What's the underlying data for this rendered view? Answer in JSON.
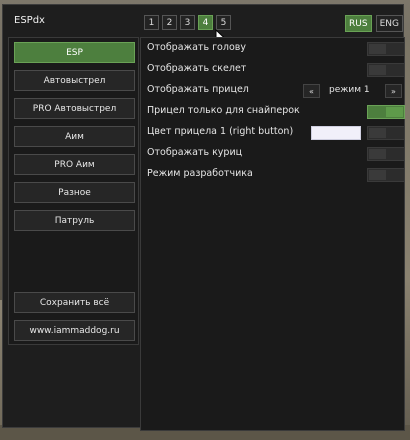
{
  "window": {
    "title": "ESPdx"
  },
  "tabs": [
    {
      "label": "1",
      "active": false
    },
    {
      "label": "2",
      "active": false
    },
    {
      "label": "3",
      "active": false
    },
    {
      "label": "4",
      "active": true
    },
    {
      "label": "5",
      "active": false
    }
  ],
  "lang": {
    "rus": "RUS",
    "eng": "ENG",
    "active": "RUS"
  },
  "sidebar": {
    "items": [
      {
        "label": "ESP",
        "active": true
      },
      {
        "label": "Автовыстрел"
      },
      {
        "label": "PRO Автовыстрел"
      },
      {
        "label": "Аим"
      },
      {
        "label": "PRO Аим"
      },
      {
        "label": "Разное"
      },
      {
        "label": "Патруль"
      }
    ],
    "save_label": "Сохранить всё",
    "site_label": "www.iammaddog.ru"
  },
  "settings": [
    {
      "label": "Отображать голову",
      "on": false
    },
    {
      "label": "Отображать скелет",
      "on": false
    },
    {
      "label": "Отображать прицел",
      "mode": "режим 1",
      "prev": "«",
      "next": "»"
    },
    {
      "label": "Прицел только для снайперок",
      "on": true
    },
    {
      "label": "Цвет прицела 1 (right button)",
      "color": "#f1f0fa",
      "on": false
    },
    {
      "label": "Отображать куриц",
      "on": false
    },
    {
      "label": "Режим разработчика",
      "on": false
    }
  ],
  "colors": {
    "accent": "#4d7f3e",
    "panel": "#1a1a1a",
    "window": "#1e1e1e"
  }
}
